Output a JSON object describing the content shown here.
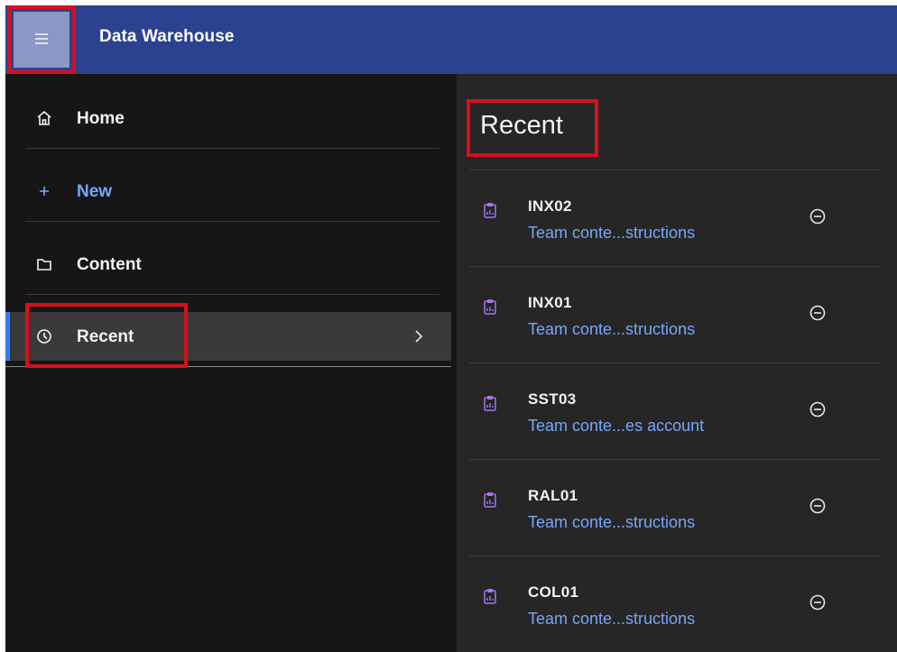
{
  "header": {
    "app_title": "Data Warehouse",
    "menu_icon": "hamburger-icon"
  },
  "sidebar": {
    "items": [
      {
        "label": "Home",
        "icon": "home-icon"
      },
      {
        "label": "New",
        "icon": "plus-icon"
      },
      {
        "label": "Content",
        "icon": "folder-icon"
      },
      {
        "label": "Recent",
        "icon": "clock-icon",
        "active": true
      }
    ]
  },
  "panel": {
    "title": "Recent",
    "items": [
      {
        "name": "INX02",
        "location": "Team conte...structions",
        "icon": "report-icon"
      },
      {
        "name": "INX01",
        "location": "Team conte...structions",
        "icon": "report-icon"
      },
      {
        "name": "SST03",
        "location": "Team conte...es account",
        "icon": "report-icon"
      },
      {
        "name": "RAL01",
        "location": "Team conte...structions",
        "icon": "report-icon"
      },
      {
        "name": "COL01",
        "location": "Team conte...structions",
        "icon": "report-icon"
      }
    ]
  },
  "colors": {
    "header_bg": "#2b4290",
    "link": "#78a6f8",
    "accent": "#2e7cf6",
    "report_icon": "#a874f0",
    "highlight": "#d7101d"
  }
}
